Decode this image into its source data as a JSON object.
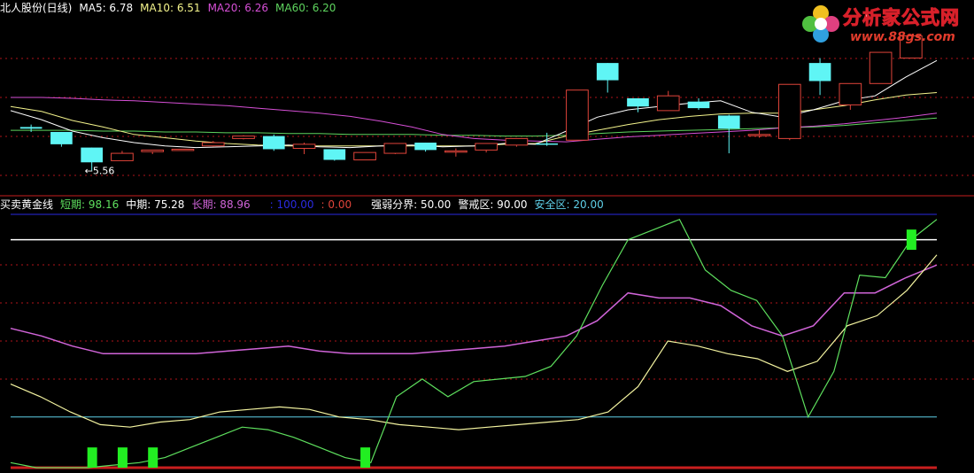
{
  "header1": {
    "stock_name": "北人股份(日线)",
    "ma5": "MA5: 6.78",
    "ma10": "MA10: 6.51",
    "ma20": "MA20: 6.26",
    "ma60": "MA60: 6.20"
  },
  "header2": {
    "indicator_name": "买卖黄金线",
    "short_term": "短期: 98.16",
    "mid_term": "中期: 75.28",
    "long_term": "长期: 88.96",
    "upper_line": ": 100.00",
    "lower_line": ": 0.00",
    "strength_divide": "强弱分界: 50.00",
    "warning_zone": "警戒区: 90.00",
    "safe_zone": "安全区: 20.00"
  },
  "price_annotation": "5.56",
  "logo": {
    "name": "分析家公式网",
    "url": "www.88gs.com"
  },
  "colors": {
    "up_candle": "#e0443a",
    "down_candle": "#5ff5f5",
    "ma5": "#ffffff",
    "ma10": "#f4f48c",
    "ma20": "#d64fd6",
    "ma60": "#5ed45e",
    "short": "#5ee05e",
    "mid": "#f4f4a0",
    "long": "#d064d8",
    "grid": "#b0141a",
    "separator": "#c81e1e",
    "line100": "#2a2ae0",
    "line90": "#ffffff",
    "line20": "#5fd0e8",
    "bar": "#22ee22"
  },
  "chart_data": {
    "type": "candlestick",
    "candles": [
      {
        "o": 6.09,
        "c": 6.07,
        "h": 6.12,
        "l": 6.03
      },
      {
        "o": 6.03,
        "c": 5.88,
        "h": 6.03,
        "l": 5.85
      },
      {
        "o": 5.84,
        "c": 5.66,
        "h": 5.84,
        "l": 5.56
      },
      {
        "o": 5.68,
        "c": 5.77,
        "h": 5.8,
        "l": 5.68
      },
      {
        "o": 5.79,
        "c": 5.81,
        "h": 5.81,
        "l": 5.76
      },
      {
        "o": 5.81,
        "c": 5.82,
        "h": 5.82,
        "l": 5.81
      },
      {
        "o": 5.86,
        "c": 5.9,
        "h": 5.92,
        "l": 5.85
      },
      {
        "o": 5.95,
        "c": 5.98,
        "h": 5.99,
        "l": 5.94
      },
      {
        "o": 5.98,
        "c": 5.82,
        "h": 6.0,
        "l": 5.8
      },
      {
        "o": 5.83,
        "c": 5.88,
        "h": 5.9,
        "l": 5.76
      },
      {
        "o": 5.82,
        "c": 5.69,
        "h": 5.82,
        "l": 5.68
      },
      {
        "o": 5.69,
        "c": 5.78,
        "h": 5.78,
        "l": 5.69
      },
      {
        "o": 5.77,
        "c": 5.89,
        "h": 5.89,
        "l": 5.76
      },
      {
        "o": 5.9,
        "c": 5.81,
        "h": 5.9,
        "l": 5.79
      },
      {
        "o": 5.79,
        "c": 5.8,
        "h": 5.83,
        "l": 5.73
      },
      {
        "o": 5.81,
        "c": 5.89,
        "h": 5.89,
        "l": 5.78
      },
      {
        "o": 5.87,
        "c": 5.95,
        "h": 5.95,
        "l": 5.85
      },
      {
        "o": 5.89,
        "c": 5.88,
        "h": 6.02,
        "l": 5.86
      },
      {
        "o": 5.93,
        "c": 6.54,
        "h": 6.54,
        "l": 5.93
      },
      {
        "o": 6.87,
        "c": 6.66,
        "h": 6.87,
        "l": 6.51
      },
      {
        "o": 6.44,
        "c": 6.34,
        "h": 6.44,
        "l": 6.27
      },
      {
        "o": 6.29,
        "c": 6.47,
        "h": 6.53,
        "l": 6.29
      },
      {
        "o": 6.4,
        "c": 6.32,
        "h": 6.44,
        "l": 6.3
      },
      {
        "o": 6.23,
        "c": 6.07,
        "h": 6.24,
        "l": 5.77
      },
      {
        "o": 6.0,
        "c": 6.0,
        "h": 6.05,
        "l": 5.96
      },
      {
        "o": 5.95,
        "c": 6.61,
        "h": 6.61,
        "l": 5.93
      },
      {
        "o": 6.87,
        "c": 6.65,
        "h": 6.93,
        "l": 6.48
      },
      {
        "o": 6.36,
        "c": 6.62,
        "h": 6.62,
        "l": 6.3
      },
      {
        "o": 6.62,
        "c": 7.0,
        "h": 7.0,
        "l": 6.63
      },
      {
        "o": 6.93,
        "c": 7.2,
        "h": 7.2,
        "l": 6.93
      }
    ],
    "ma5": [
      6.29,
      6.18,
      6.04,
      5.96,
      5.9,
      5.86,
      5.84,
      5.85,
      5.86,
      5.87,
      5.85,
      5.84,
      5.86,
      5.87,
      5.85,
      5.86,
      5.89,
      5.88,
      6.04,
      6.21,
      6.3,
      6.34,
      6.38,
      6.41,
      6.27,
      6.21,
      6.3,
      6.41,
      6.47,
      6.7,
      6.9
    ],
    "ma10": [
      6.34,
      6.28,
      6.17,
      6.09,
      6.0,
      5.96,
      5.92,
      5.89,
      5.87,
      5.86,
      5.86,
      5.86,
      5.86,
      5.86,
      5.86,
      5.86,
      5.88,
      5.89,
      5.98,
      6.05,
      6.12,
      6.18,
      6.22,
      6.25,
      6.26,
      6.26,
      6.3,
      6.35,
      6.42,
      6.48,
      6.51
    ],
    "ma20": [
      6.45,
      6.45,
      6.44,
      6.42,
      6.41,
      6.39,
      6.37,
      6.35,
      6.32,
      6.29,
      6.26,
      6.22,
      6.16,
      6.09,
      6.0,
      5.95,
      5.93,
      5.92,
      5.91,
      5.94,
      5.97,
      5.99,
      6.01,
      6.03,
      6.05,
      6.08,
      6.1,
      6.13,
      6.17,
      6.21,
      6.26
    ],
    "ma60": [
      6.05,
      6.05,
      6.05,
      6.04,
      6.04,
      6.03,
      6.03,
      6.02,
      6.02,
      6.01,
      6.01,
      6.0,
      6.0,
      6.0,
      5.99,
      5.99,
      5.98,
      5.98,
      5.99,
      6.01,
      6.03,
      6.04,
      6.05,
      6.06,
      6.07,
      6.08,
      6.09,
      6.11,
      6.14,
      6.17,
      6.2
    ],
    "price_range": [
      5.35,
      7.4
    ],
    "indicator": {
      "range": [
        0,
        100
      ],
      "short": [
        2,
        0,
        0,
        0,
        1,
        2,
        4,
        8,
        12,
        16,
        15,
        12,
        8,
        4,
        2,
        28,
        35,
        28,
        34,
        35,
        36,
        40,
        52,
        72,
        90,
        94,
        98,
        78,
        70,
        66,
        52,
        20,
        38,
        76,
        75,
        90,
        98
      ],
      "mid": [
        33,
        28,
        22,
        17,
        16,
        18,
        19,
        22,
        23,
        24,
        23,
        20,
        19,
        17,
        16,
        15,
        16,
        17,
        18,
        19,
        22,
        32,
        50,
        48,
        45,
        43,
        38,
        42,
        56,
        60,
        70,
        84
      ],
      "long": [
        55,
        52,
        48,
        45,
        45,
        45,
        45,
        46,
        47,
        48,
        46,
        45,
        45,
        45,
        46,
        47,
        48,
        50,
        52,
        58,
        69,
        67,
        67,
        64,
        56,
        52,
        56,
        69,
        69,
        75,
        80
      ],
      "levels": {
        "upper": 100,
        "warning": 90,
        "divide": 50,
        "safe": 20,
        "lower": 0
      },
      "signal_bars": [
        2,
        3,
        4,
        11,
        29
      ]
    }
  }
}
